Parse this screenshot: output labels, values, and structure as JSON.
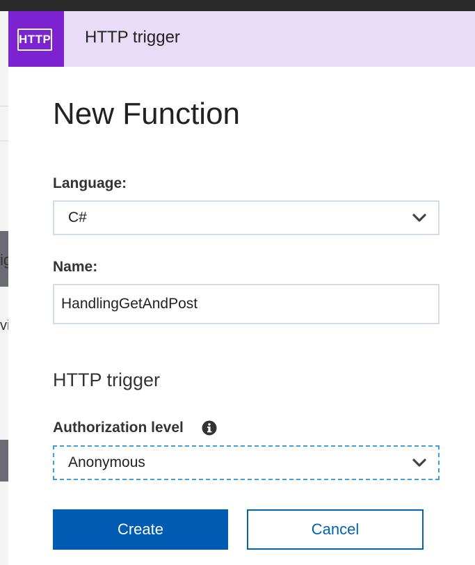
{
  "header": {
    "badge_text": "HTTP",
    "title": "HTTP trigger"
  },
  "page": {
    "title": "New Function"
  },
  "language": {
    "label": "Language:",
    "value": "C#"
  },
  "name": {
    "label": "Name:",
    "value": "HandlingGetAndPost"
  },
  "section": {
    "title": "HTTP trigger"
  },
  "authorization": {
    "label": "Authorization level",
    "value": "Anonymous"
  },
  "buttons": {
    "create": "Create",
    "cancel": "Cancel"
  },
  "background": {
    "fragment_1": "ig",
    "fragment_2": "vi"
  },
  "colors": {
    "header_bg": "#e9dcf7",
    "badge_bg": "#7d22d0",
    "primary_button": "#005bb3",
    "secondary_border": "#0063b1",
    "focus_border": "#3aa0dc"
  },
  "icons": {
    "badge": "http-icon",
    "dropdown": "chevron-down-icon",
    "info": "info-icon"
  }
}
